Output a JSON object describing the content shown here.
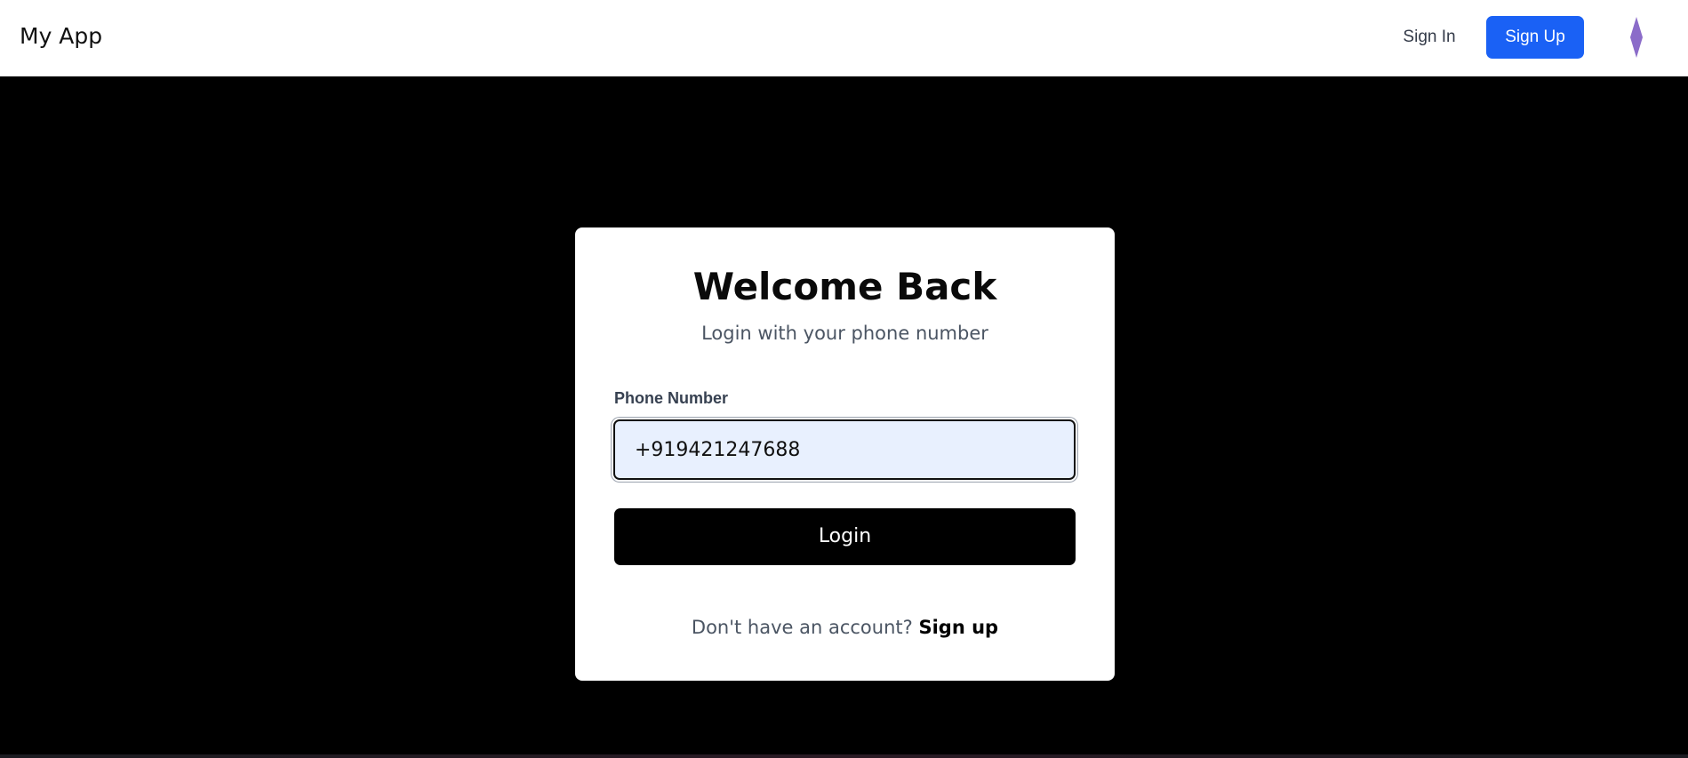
{
  "navbar": {
    "brand": "My App",
    "sign_in_label": "Sign In",
    "sign_up_label": "Sign Up",
    "logo_icon": "diamond-logo-icon",
    "colors": {
      "primary": "#1a61f5",
      "logo": "#8b6cc9"
    }
  },
  "login_card": {
    "title": "Welcome Back",
    "subtitle": "Login with your phone number",
    "phone_label": "Phone Number",
    "phone_value": "+919421247688",
    "login_button_label": "Login",
    "footer_prompt": "Don't have an account?",
    "footer_link_label": "Sign up"
  }
}
